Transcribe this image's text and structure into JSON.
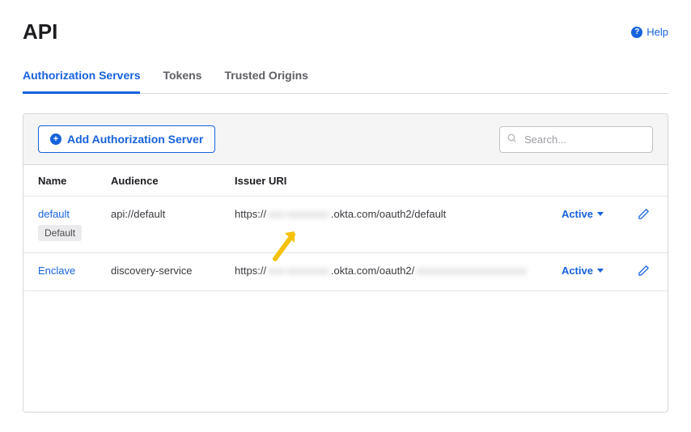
{
  "header": {
    "title": "API",
    "help": "Help"
  },
  "tabs": [
    {
      "label": "Authorization Servers",
      "active": true
    },
    {
      "label": "Tokens",
      "active": false
    },
    {
      "label": "Trusted Origins",
      "active": false
    }
  ],
  "toolbar": {
    "addButton": "Add Authorization Server",
    "searchPlaceholder": "Search..."
  },
  "table": {
    "headers": {
      "name": "Name",
      "audience": "Audience",
      "issuer": "Issuer URI"
    },
    "rows": [
      {
        "name": "default",
        "badge": "Default",
        "audience": "api://default",
        "uriPrefix": "https://",
        "uriBlur": "xxx-xxxxxxxx",
        "uriMid": ".okta.com/oauth2/",
        "uriSuffix": "default",
        "suffixBlur": false,
        "status": "Active"
      },
      {
        "name": "Enclave",
        "badge": "",
        "audience": "discovery-service",
        "uriPrefix": "https://",
        "uriBlur": "xxx-xxxxxxxx",
        "uriMid": ".okta.com/oauth2/",
        "uriSuffix": "xxxxxxxxxxxxxxxxxxxxx",
        "suffixBlur": true,
        "status": "Active"
      }
    ]
  }
}
